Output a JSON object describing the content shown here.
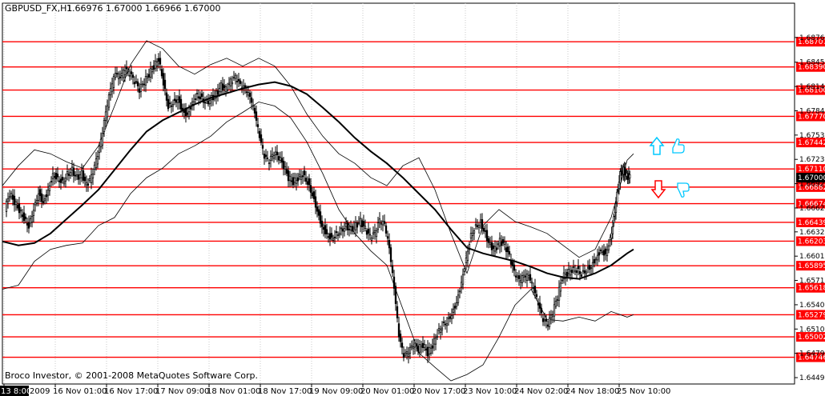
{
  "header": {
    "symbol": "GBPUSD_FX,H1",
    "ohlc": "1.66976 1.67000 1.66966 1.67000"
  },
  "footer": {
    "copyright": "Broco Investor, © 2001-2008 MetaQuotes Software Corp."
  },
  "colors": {
    "level_line": "#ff0000",
    "level_label_bg": "#ff0000",
    "current_price_bg": "#000000",
    "up_arrow": "#00c8ff",
    "down_arrow": "#ff0000",
    "ma": "#000000",
    "bands": "#000000",
    "candles": "#000000"
  },
  "icons": {
    "buy_signal": "up-arrow-icon",
    "buy_hand": "thumbs-up-icon",
    "sell_signal": "down-arrow-icon",
    "sell_hand": "thumbs-down-icon"
  },
  "chart_data": {
    "type": "candlestick",
    "symbol": "GBPUSD_FX",
    "timeframe": "H1",
    "ylim": [
      1.6441,
      1.6905
    ],
    "y_ticks": [
      "1.68760",
      "1.68450",
      "1.68145",
      "1.67840",
      "1.67535",
      "1.67230",
      "1.66925",
      "1.66620",
      "1.66320",
      "1.66015",
      "1.65710",
      "1.65405",
      "1.65100",
      "1.64795",
      "1.64490"
    ],
    "x_ticks": [
      "13 8:00",
      "16 Nov 01:00",
      "16 Nov 17:00",
      "17 Nov 09:00",
      "18 Nov 01:00",
      "18 Nov 17:00",
      "19 Nov 09:00",
      "20 Nov 01:00",
      "20 Nov 17:00",
      "23 Nov 10:00",
      "24 Nov 02:00",
      "24 Nov 18:00",
      "25 Nov 10:00"
    ],
    "x_tick_prefix": "20",
    "x_tick_partial": "2009",
    "levels": [
      "1.68707",
      "1.68390",
      "1.68100",
      "1.67770",
      "1.67442",
      "1.67110",
      "1.66882",
      "1.66674",
      "1.66439",
      "1.66203",
      "1.65895",
      "1.65618",
      "1.65279",
      "1.65002",
      "1.64746"
    ],
    "current_price": "1.67000",
    "series": [
      {
        "name": "ma",
        "values": [
          [
            0,
            1.662
          ],
          [
            20,
            1.6615
          ],
          [
            40,
            1.6618
          ],
          [
            60,
            1.663
          ],
          [
            80,
            1.6648
          ],
          [
            100,
            1.6666
          ],
          [
            120,
            1.6685
          ],
          [
            140,
            1.671
          ],
          [
            160,
            1.6735
          ],
          [
            180,
            1.6758
          ],
          [
            200,
            1.6772
          ],
          [
            220,
            1.6782
          ],
          [
            240,
            1.6792
          ],
          [
            260,
            1.68
          ],
          [
            280,
            1.6806
          ],
          [
            300,
            1.6812
          ],
          [
            320,
            1.6817
          ],
          [
            340,
            1.682
          ],
          [
            360,
            1.6815
          ],
          [
            380,
            1.6805
          ],
          [
            400,
            1.6788
          ],
          [
            420,
            1.677
          ],
          [
            440,
            1.675
          ],
          [
            460,
            1.6733
          ],
          [
            480,
            1.6718
          ],
          [
            500,
            1.67
          ],
          [
            520,
            1.668
          ],
          [
            540,
            1.666
          ],
          [
            560,
            1.6635
          ],
          [
            580,
            1.6612
          ],
          [
            600,
            1.6605
          ],
          [
            620,
            1.66
          ],
          [
            640,
            1.6595
          ],
          [
            660,
            1.6588
          ],
          [
            680,
            1.658
          ],
          [
            700,
            1.6575
          ],
          [
            720,
            1.6573
          ],
          [
            740,
            1.658
          ],
          [
            760,
            1.659
          ],
          [
            780,
            1.6605
          ],
          [
            788,
            1.661
          ]
        ]
      },
      {
        "name": "band_upper",
        "values": [
          [
            0,
            1.669
          ],
          [
            20,
            1.6715
          ],
          [
            40,
            1.6735
          ],
          [
            60,
            1.673
          ],
          [
            80,
            1.672
          ],
          [
            100,
            1.6712
          ],
          [
            120,
            1.674
          ],
          [
            140,
            1.679
          ],
          [
            160,
            1.6842
          ],
          [
            180,
            1.6872
          ],
          [
            200,
            1.6862
          ],
          [
            220,
            1.684
          ],
          [
            240,
            1.683
          ],
          [
            260,
            1.6842
          ],
          [
            280,
            1.685
          ],
          [
            300,
            1.684
          ],
          [
            320,
            1.685
          ],
          [
            340,
            1.684
          ],
          [
            360,
            1.6815
          ],
          [
            380,
            1.678
          ],
          [
            400,
            1.6752
          ],
          [
            420,
            1.673
          ],
          [
            440,
            1.6718
          ],
          [
            460,
            1.67
          ],
          [
            480,
            1.669
          ],
          [
            500,
            1.6715
          ],
          [
            520,
            1.6725
          ],
          [
            540,
            1.6685
          ],
          [
            560,
            1.663
          ],
          [
            580,
            1.658
          ],
          [
            600,
            1.664
          ],
          [
            620,
            1.666
          ],
          [
            640,
            1.6645
          ],
          [
            660,
            1.6638
          ],
          [
            680,
            1.663
          ],
          [
            700,
            1.6615
          ],
          [
            720,
            1.66
          ],
          [
            740,
            1.661
          ],
          [
            760,
            1.665
          ],
          [
            780,
            1.6722
          ],
          [
            788,
            1.673
          ]
        ]
      },
      {
        "name": "band_lower",
        "values": [
          [
            0,
            1.656
          ],
          [
            20,
            1.6565
          ],
          [
            40,
            1.6595
          ],
          [
            60,
            1.661
          ],
          [
            80,
            1.6615
          ],
          [
            100,
            1.6618
          ],
          [
            120,
            1.664
          ],
          [
            140,
            1.665
          ],
          [
            160,
            1.668
          ],
          [
            180,
            1.67
          ],
          [
            200,
            1.6712
          ],
          [
            220,
            1.673
          ],
          [
            240,
            1.674
          ],
          [
            260,
            1.6752
          ],
          [
            280,
            1.677
          ],
          [
            300,
            1.6782
          ],
          [
            320,
            1.6795
          ],
          [
            340,
            1.679
          ],
          [
            360,
            1.6775
          ],
          [
            380,
            1.6745
          ],
          [
            400,
            1.6705
          ],
          [
            420,
            1.666
          ],
          [
            440,
            1.663
          ],
          [
            460,
            1.6608
          ],
          [
            480,
            1.659
          ],
          [
            500,
            1.6535
          ],
          [
            520,
            1.648
          ],
          [
            540,
            1.6462
          ],
          [
            560,
            1.6445
          ],
          [
            580,
            1.6453
          ],
          [
            600,
            1.6465
          ],
          [
            620,
            1.65
          ],
          [
            640,
            1.654
          ],
          [
            660,
            1.656
          ],
          [
            680,
            1.6522
          ],
          [
            700,
            1.652
          ],
          [
            720,
            1.6525
          ],
          [
            740,
            1.652
          ],
          [
            760,
            1.6532
          ],
          [
            780,
            1.6525
          ],
          [
            788,
            1.6528
          ]
        ]
      },
      {
        "name": "price",
        "values": [
          [
            4,
            1.666
          ],
          [
            10,
            1.668
          ],
          [
            16,
            1.667
          ],
          [
            22,
            1.666
          ],
          [
            28,
            1.665
          ],
          [
            34,
            1.664
          ],
          [
            40,
            1.6662
          ],
          [
            46,
            1.6682
          ],
          [
            52,
            1.667
          ],
          [
            58,
            1.6685
          ],
          [
            64,
            1.6705
          ],
          [
            70,
            1.67
          ],
          [
            76,
            1.6695
          ],
          [
            82,
            1.6705
          ],
          [
            88,
            1.671
          ],
          [
            94,
            1.67
          ],
          [
            100,
            1.6705
          ],
          [
            106,
            1.669
          ],
          [
            112,
            1.67
          ],
          [
            118,
            1.672
          ],
          [
            124,
            1.6745
          ],
          [
            130,
            1.678
          ],
          [
            136,
            1.681
          ],
          [
            142,
            1.683
          ],
          [
            148,
            1.6825
          ],
          [
            154,
            1.6835
          ],
          [
            160,
            1.683
          ],
          [
            166,
            1.682
          ],
          [
            172,
            1.681
          ],
          [
            178,
            1.682
          ],
          [
            184,
            1.683
          ],
          [
            190,
            1.684
          ],
          [
            196,
            1.685
          ],
          [
            202,
            1.682
          ],
          [
            208,
            1.679
          ],
          [
            214,
            1.6795
          ],
          [
            220,
            1.68
          ],
          [
            226,
            1.6785
          ],
          [
            232,
            1.678
          ],
          [
            238,
            1.6795
          ],
          [
            244,
            1.6805
          ],
          [
            250,
            1.68
          ],
          [
            256,
            1.6795
          ],
          [
            262,
            1.68
          ],
          [
            268,
            1.6805
          ],
          [
            274,
            1.6815
          ],
          [
            280,
            1.681
          ],
          [
            286,
            1.682
          ],
          [
            292,
            1.6825
          ],
          [
            298,
            1.6815
          ],
          [
            304,
            1.681
          ],
          [
            310,
            1.68
          ],
          [
            316,
            1.678
          ],
          [
            322,
            1.675
          ],
          [
            328,
            1.6725
          ],
          [
            334,
            1.672
          ],
          [
            340,
            1.673
          ],
          [
            346,
            1.6725
          ],
          [
            352,
            1.6715
          ],
          [
            358,
            1.67
          ],
          [
            364,
            1.6695
          ],
          [
            370,
            1.67
          ],
          [
            376,
            1.6705
          ],
          [
            382,
            1.6695
          ],
          [
            388,
            1.668
          ],
          [
            394,
            1.666
          ],
          [
            400,
            1.664
          ],
          [
            406,
            1.663
          ],
          [
            412,
            1.6625
          ],
          [
            418,
            1.663
          ],
          [
            424,
            1.6635
          ],
          [
            430,
            1.664
          ],
          [
            436,
            1.6635
          ],
          [
            442,
            1.664
          ],
          [
            448,
            1.6645
          ],
          [
            454,
            1.6635
          ],
          [
            460,
            1.6625
          ],
          [
            466,
            1.663
          ],
          [
            472,
            1.6645
          ],
          [
            478,
            1.664
          ],
          [
            484,
            1.661
          ],
          [
            490,
            1.656
          ],
          [
            496,
            1.65
          ],
          [
            502,
            1.6475
          ],
          [
            508,
            1.648
          ],
          [
            514,
            1.649
          ],
          [
            520,
            1.6485
          ],
          [
            526,
            1.649
          ],
          [
            532,
            1.648
          ],
          [
            538,
            1.649
          ],
          [
            544,
            1.6505
          ],
          [
            550,
            1.6515
          ],
          [
            556,
            1.652
          ],
          [
            562,
            1.653
          ],
          [
            568,
            1.6545
          ],
          [
            574,
            1.657
          ],
          [
            580,
            1.66
          ],
          [
            586,
            1.663
          ],
          [
            592,
            1.664
          ],
          [
            598,
            1.6645
          ],
          [
            604,
            1.663
          ],
          [
            610,
            1.6615
          ],
          [
            616,
            1.661
          ],
          [
            622,
            1.662
          ],
          [
            628,
            1.6615
          ],
          [
            634,
            1.66
          ],
          [
            640,
            1.658
          ],
          [
            646,
            1.657
          ],
          [
            652,
            1.6575
          ],
          [
            658,
            1.6575
          ],
          [
            664,
            1.656
          ],
          [
            670,
            1.654
          ],
          [
            676,
            1.652
          ],
          [
            682,
            1.6515
          ],
          [
            688,
            1.653
          ],
          [
            694,
            1.655
          ],
          [
            700,
            1.6575
          ],
          [
            706,
            1.658
          ],
          [
            712,
            1.6585
          ],
          [
            718,
            1.6585
          ],
          [
            724,
            1.658
          ],
          [
            730,
            1.6585
          ],
          [
            736,
            1.659
          ],
          [
            742,
            1.66
          ],
          [
            748,
            1.661
          ],
          [
            754,
            1.6605
          ],
          [
            760,
            1.6625
          ],
          [
            764,
            1.665
          ],
          [
            768,
            1.668
          ],
          [
            772,
            1.6705
          ],
          [
            776,
            1.671
          ],
          [
            780,
            1.6702
          ],
          [
            784,
            1.67
          ]
        ]
      }
    ]
  }
}
